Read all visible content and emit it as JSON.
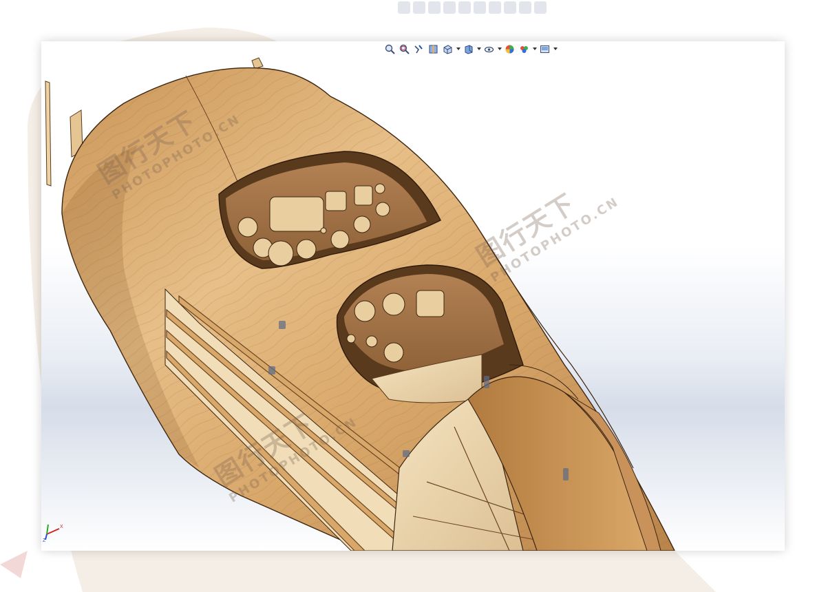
{
  "app": {
    "kind": "3D CAD viewport",
    "background_top": "#ffffff",
    "background_bottom": "#d6dde9",
    "accent": "#1f4fb5"
  },
  "heads_up_toolbar": {
    "tools": [
      {
        "icon": "zoom-to-fit-icon"
      },
      {
        "icon": "zoom-to-area-icon"
      },
      {
        "icon": "previous-view-icon"
      },
      {
        "icon": "section-view-icon"
      },
      {
        "icon": "view-orientation-icon",
        "has_menu": true
      },
      {
        "icon": "display-style-icon",
        "has_menu": true
      },
      {
        "icon": "hide-show-items-icon",
        "has_menu": true
      },
      {
        "icon": "edit-appearance-icon"
      },
      {
        "icon": "apply-scene-icon",
        "has_menu": true
      },
      {
        "icon": "view-settings-icon",
        "has_menu": true
      }
    ]
  },
  "model": {
    "material": "wood",
    "color_light": "#e6bd86",
    "color_mid": "#d39f63",
    "color_dark": "#a9743d",
    "interior_color": "#f0dcb4"
  },
  "triad": {
    "x_label": "X",
    "z_label": "Z",
    "x_color": "#cc2a2a",
    "y_color": "#2aa82a",
    "z_color": "#2a4ecc"
  },
  "watermarks": [
    {
      "main": "图行天下",
      "sub": "PHOTOPHOTO.CN"
    },
    {
      "main": "图行天下",
      "sub": "PHOTOPHOTO.CN"
    },
    {
      "main": "图行天下",
      "sub": "PHOTOPHOTO.CN"
    }
  ]
}
